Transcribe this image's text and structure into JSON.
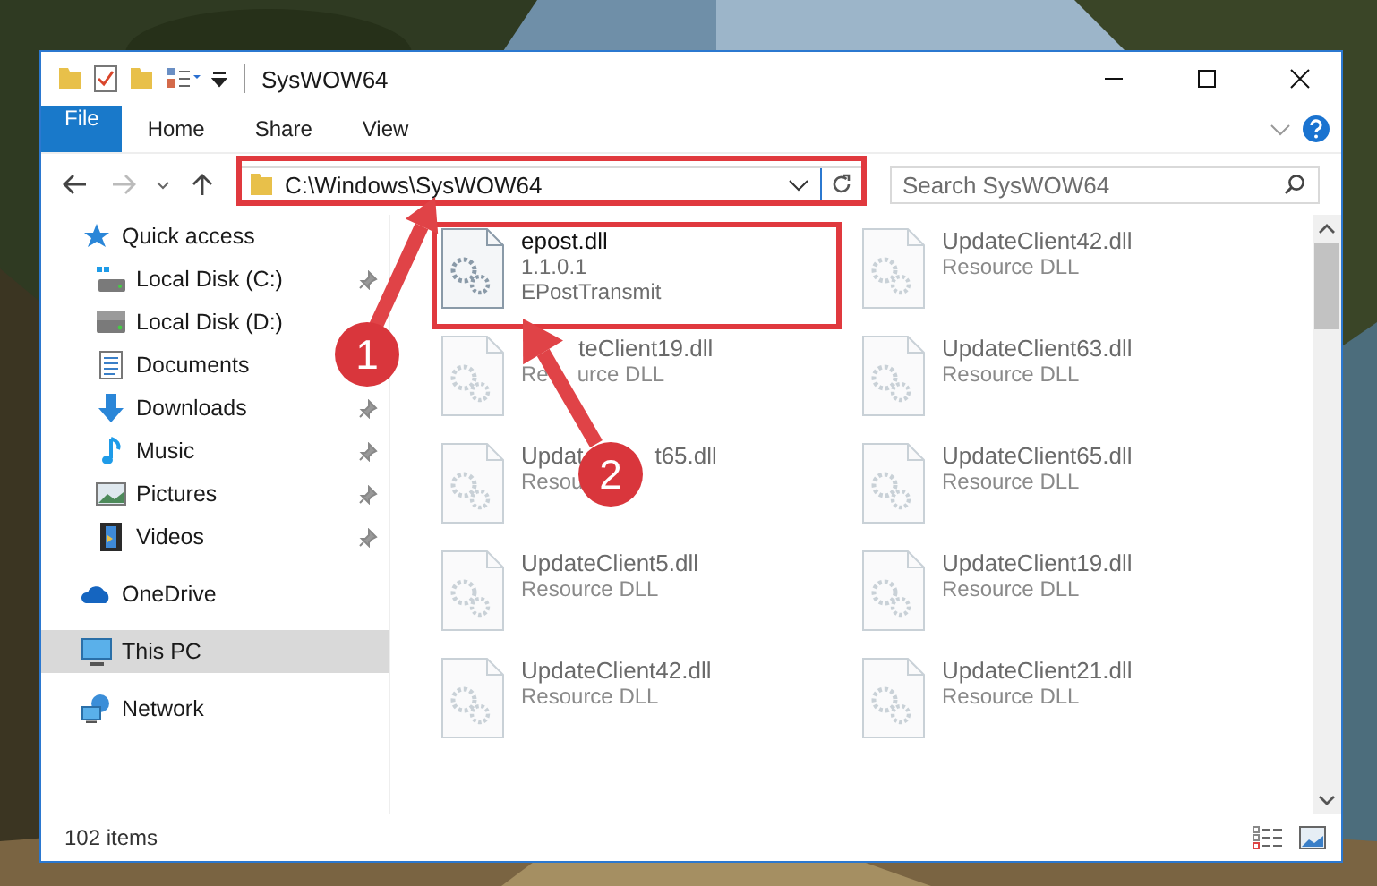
{
  "window": {
    "title": "SysWOW64"
  },
  "ribbon_tabs": [
    {
      "label": "File",
      "kind": "file",
      "selected": false
    },
    {
      "label": "Home",
      "kind": "tab",
      "selected": false
    },
    {
      "label": "Share",
      "kind": "tab",
      "selected": false
    },
    {
      "label": "View",
      "kind": "tab",
      "selected": false
    }
  ],
  "address": {
    "path": "C:\\Windows\\SysWOW64"
  },
  "search": {
    "placeholder": "Search SysWOW64"
  },
  "sidebar": {
    "items": [
      {
        "label": "Quick access",
        "kind": "star",
        "pinned": false,
        "selected": false,
        "children": [
          {
            "label": "Local Disk (C:)",
            "kind": "system-drive",
            "pinned": true,
            "selected": false
          },
          {
            "label": "Local Disk (D:)",
            "kind": "drive",
            "pinned": false,
            "selected": false
          },
          {
            "label": "Documents",
            "kind": "documents",
            "pinned": false,
            "selected": false
          },
          {
            "label": "Downloads",
            "kind": "downloads",
            "pinned": true,
            "selected": false
          },
          {
            "label": "Music",
            "kind": "music",
            "pinned": true,
            "selected": false
          },
          {
            "label": "Pictures",
            "kind": "pictures",
            "pinned": true,
            "selected": false
          },
          {
            "label": "Videos",
            "kind": "videos",
            "pinned": true,
            "selected": false
          }
        ]
      },
      {
        "label": "OneDrive",
        "kind": "cloud",
        "pinned": false,
        "selected": false
      },
      {
        "label": "This PC",
        "kind": "computer",
        "pinned": false,
        "selected": true
      },
      {
        "label": "Network",
        "kind": "network",
        "pinned": false,
        "selected": false
      }
    ]
  },
  "files": [
    {
      "name": [
        "epost.dll"
      ],
      "details": [
        [
          "1.1.0.1"
        ],
        [
          "EPostTransmit"
        ]
      ],
      "faded": false
    },
    {
      "name": [
        "UpdateClient42.dll"
      ],
      "details": [
        [
          "Resource DLL"
        ]
      ],
      "faded": true
    },
    {
      "name": [
        "teClient19.dll"
      ],
      "details": [
        [
          "Re",
          "urce DLL"
        ]
      ],
      "faded": true,
      "start_covered": true
    },
    {
      "name": [
        "UpdateClient63.dll"
      ],
      "details": [
        [
          "Resource DLL"
        ]
      ],
      "faded": true
    },
    {
      "name": [
        "Updat",
        "t65.dll"
      ],
      "details": [
        [
          "Resou"
        ]
      ],
      "faded": true
    },
    {
      "name": [
        "UpdateClient65.dll"
      ],
      "details": [
        [
          "Resource DLL"
        ]
      ],
      "faded": true
    },
    {
      "name": [
        "UpdateClient5.dll"
      ],
      "details": [
        [
          "Resource DLL"
        ]
      ],
      "faded": true
    },
    {
      "name": [
        "UpdateClient19.dll"
      ],
      "details": [
        [
          "Resource DLL"
        ]
      ],
      "faded": true
    },
    {
      "name": [
        "UpdateClient42.dll"
      ],
      "details": [
        [
          "Resource DLL"
        ]
      ],
      "faded": true
    },
    {
      "name": [
        "UpdateClient21.dll"
      ],
      "details": [
        [
          "Resource DLL"
        ]
      ],
      "faded": true
    }
  ],
  "status_bar": {
    "item_count": "102 items"
  },
  "annotations": [
    {
      "number": "1"
    },
    {
      "number": "2"
    }
  ]
}
